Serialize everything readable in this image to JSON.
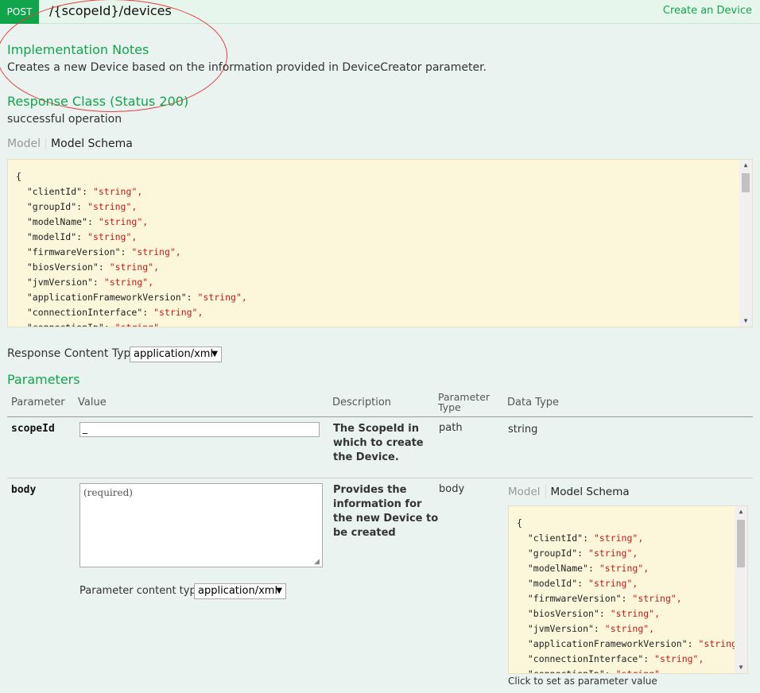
{
  "header": {
    "method": "POST",
    "path": "/{scopeId}/devices",
    "summary": "Create an Device"
  },
  "implementation": {
    "title": "Implementation Notes",
    "text": "Creates a new Device based on the information provided in DeviceCreator parameter."
  },
  "response": {
    "title": "Response Class (Status 200)",
    "text": "successful operation",
    "tab_model": "Model",
    "tab_schema": "Model Schema",
    "schema_lines": [
      [
        "{",
        ""
      ],
      [
        "  \"clientId\": ",
        "\"string\","
      ],
      [
        "  \"groupId\": ",
        "\"string\","
      ],
      [
        "  \"modelName\": ",
        "\"string\","
      ],
      [
        "  \"modelId\": ",
        "\"string\","
      ],
      [
        "  \"firmwareVersion\": ",
        "\"string\","
      ],
      [
        "  \"biosVersion\": ",
        "\"string\","
      ],
      [
        "  \"jvmVersion\": ",
        "\"string\","
      ],
      [
        "  \"applicationFrameworkVersion\": ",
        "\"string\","
      ],
      [
        "  \"connectionInterface\": ",
        "\"string\","
      ],
      [
        "  \"connectionIp\": ",
        "\"string\""
      ]
    ],
    "content_type_label": "Response Content Type",
    "content_type_value": "application/xml"
  },
  "parameters": {
    "title": "Parameters",
    "columns": {
      "parameter": "Parameter",
      "value": "Value",
      "description": "Description",
      "type_line1": "Parameter",
      "type_line2": "Type",
      "data_type": "Data Type"
    },
    "rows": [
      {
        "name": "scopeId",
        "value": "_",
        "description": [
          "The ScopeId in",
          "which to create",
          "the Device."
        ],
        "param_type": "path",
        "data_type": "string"
      },
      {
        "name": "body",
        "placeholder": "(required)",
        "content_type_label": "Parameter content type:",
        "content_type_value": "application/xml",
        "description": [
          "Provides the",
          "information for",
          "the new Device to",
          "be created"
        ],
        "param_type": "body",
        "tab_model": "Model",
        "tab_schema": "Model Schema",
        "hint": "Click to set as parameter value"
      }
    ]
  }
}
